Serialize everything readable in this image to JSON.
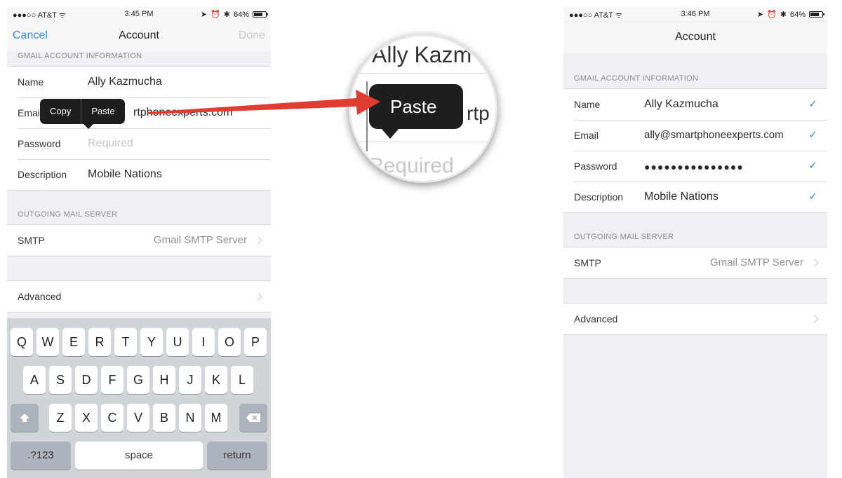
{
  "left": {
    "status": {
      "carrier": "●●●○○ AT&T ᯤ",
      "time": "3:45 PM",
      "battery": "64%"
    },
    "nav": {
      "cancel": "Cancel",
      "title": "Account",
      "done": "Done"
    },
    "section1": "GMAIL ACCOUNT INFORMATION",
    "rows": {
      "name_label": "Name",
      "name_value": "Ally Kazmucha",
      "email_label": "Email",
      "email_value": "rtphoneexperts.com",
      "password_label": "Password",
      "password_placeholder": "Required",
      "description_label": "Description",
      "description_value": "Mobile Nations"
    },
    "section2": "OUTGOING MAIL SERVER",
    "smtp_label": "SMTP",
    "smtp_value": "Gmail SMTP Server",
    "advanced_label": "Advanced",
    "menu": {
      "copy": "Copy",
      "paste": "Paste"
    },
    "keyboard": {
      "row1": [
        "Q",
        "W",
        "E",
        "R",
        "T",
        "Y",
        "U",
        "I",
        "O",
        "P"
      ],
      "row2": [
        "A",
        "S",
        "D",
        "F",
        "G",
        "H",
        "J",
        "K",
        "L"
      ],
      "row3": [
        "Z",
        "X",
        "C",
        "V",
        "B",
        "N",
        "M"
      ],
      "numbers": ".?123",
      "space": "space",
      "return": "return",
      "shift_icon": "shift-icon",
      "delete_icon": "delete-icon"
    }
  },
  "magnifier": {
    "name": "Ally Kazm",
    "paste": "Paste",
    "email_fragment": "rtp",
    "placeholder": "Required"
  },
  "right": {
    "status": {
      "carrier": "●●●○○ AT&T ᯤ",
      "time": "3:46 PM",
      "battery": "64%"
    },
    "nav": {
      "title": "Account"
    },
    "section1": "GMAIL ACCOUNT INFORMATION",
    "rows": {
      "name_label": "Name",
      "name_value": "Ally Kazmucha",
      "email_label": "Email",
      "email_value": "ally@smartphoneexperts.com",
      "password_label": "Password",
      "password_value": "●●●●●●●●●●●●●●●",
      "description_label": "Description",
      "description_value": "Mobile Nations"
    },
    "section2": "OUTGOING MAIL SERVER",
    "smtp_label": "SMTP",
    "smtp_value": "Gmail SMTP Server",
    "advanced_label": "Advanced"
  },
  "colors": {
    "accent": "#3b87d8",
    "arrow": "#e03c31",
    "background": "#efeff4"
  }
}
